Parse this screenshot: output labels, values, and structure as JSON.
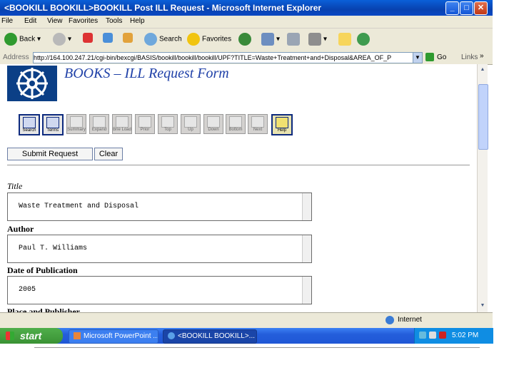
{
  "window": {
    "title": "<BOOKILL BOOKILL>BOOKILL Post ILL Request - Microsoft Internet Explorer",
    "minimize": "_",
    "maximize": "□",
    "close": "✕"
  },
  "menu": [
    "File",
    "Edit",
    "View",
    "Favorites",
    "Tools",
    "Help"
  ],
  "toolbar": {
    "back": "Back",
    "search": "Search",
    "favorites": "Favorites"
  },
  "address": {
    "label": "Address",
    "url": "http://164.100.247.21/cgi-bin/bexcgi/BASIS/bookill/bookill/bookill/UPF?TITLE=Waste+Treatment+and+Disposal&AREA_OF_P",
    "go": "Go",
    "links": "Links"
  },
  "page": {
    "form_title": "BOOKS  –  ILL Request Form",
    "icon_buttons": [
      "Search",
      "Terms",
      "Summary",
      "Expand",
      "Brie Load",
      "Prior",
      "Top",
      "Up",
      "Down",
      "Bottom",
      "Next",
      "Help"
    ],
    "submit_label": "Submit Request",
    "clear_label": "Clear",
    "fields": [
      {
        "label": "Title",
        "value": "Waste Treatment and Disposal"
      },
      {
        "label": "Author",
        "value": "Paul T. Williams"
      },
      {
        "label": "Date of Publication",
        "value": "2005"
      },
      {
        "label": "Place and Publisher",
        "value": ""
      }
    ]
  },
  "status": {
    "zone": "Internet"
  },
  "taskbar": {
    "start": "start",
    "tasks": [
      "Microsoft PowerPoint ...",
      "<BOOKILL BOOKILL>..."
    ],
    "time": "5:02 PM"
  }
}
